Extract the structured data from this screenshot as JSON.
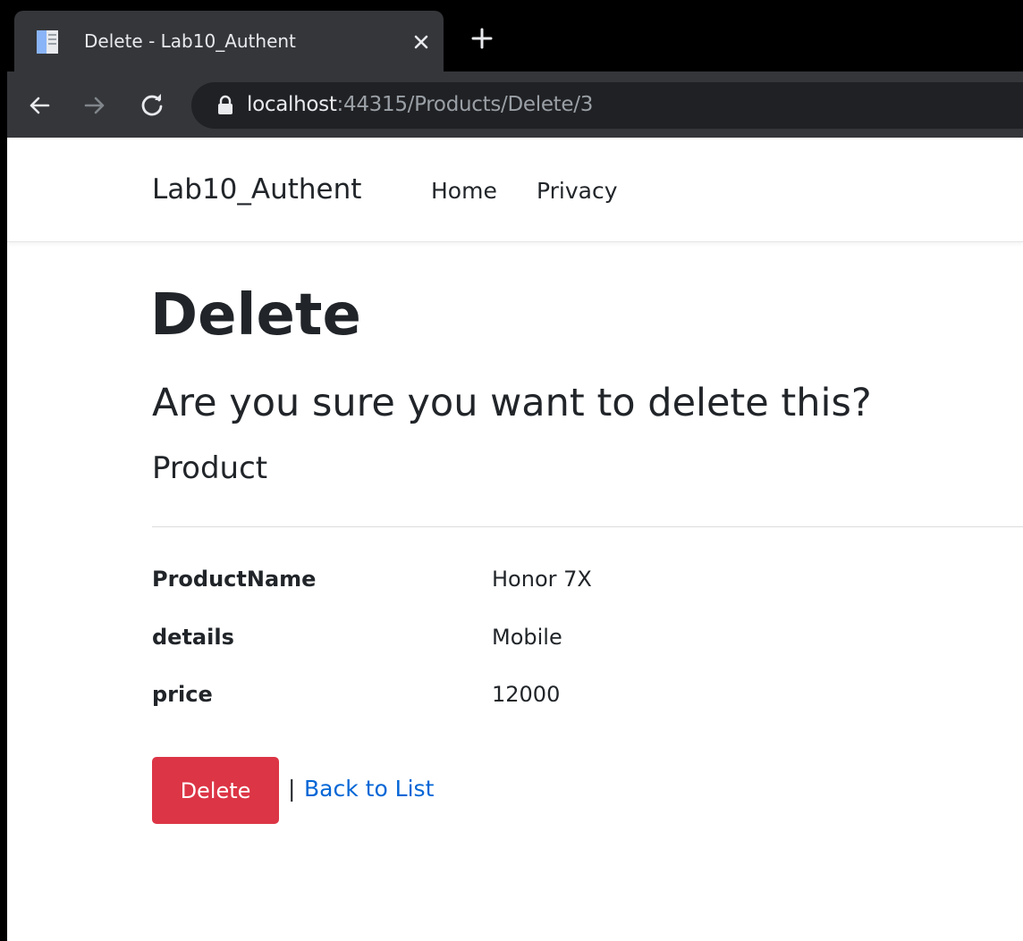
{
  "browser": {
    "tab": {
      "title": "Delete - Lab10_Authent"
    },
    "address": {
      "host": "localhost",
      "rest": ":44315/Products/Delete/3"
    }
  },
  "navbar": {
    "brand": "Lab10_Authent",
    "links": [
      "Home",
      "Privacy"
    ]
  },
  "page": {
    "title": "Delete",
    "question": "Are you sure you want to delete this?",
    "entity": "Product",
    "fields": [
      {
        "label": "ProductName",
        "value": "Honor 7X"
      },
      {
        "label": "details",
        "value": "Mobile"
      },
      {
        "label": "price",
        "value": "12000"
      }
    ],
    "delete_label": "Delete",
    "separator": "|",
    "back_label": "Back to List"
  },
  "colors": {
    "danger": "#dc3545",
    "link": "#0366d6",
    "chrome_dark": "#35363a"
  },
  "icons": [
    "document-icon",
    "close-icon",
    "plus-icon",
    "back-arrow-icon",
    "forward-arrow-icon",
    "reload-icon",
    "lock-icon"
  ]
}
